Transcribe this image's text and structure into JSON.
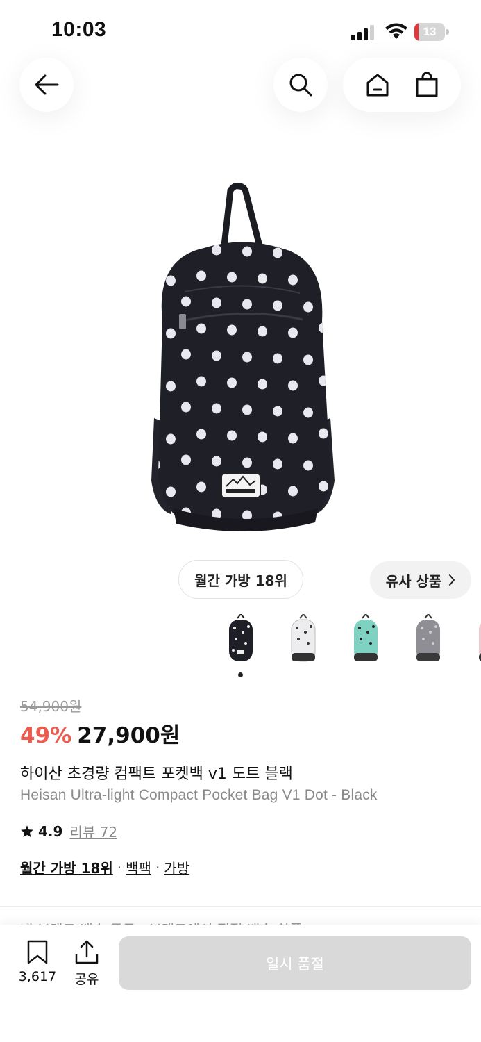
{
  "status_bar": {
    "time": "10:03",
    "battery_level": "13",
    "battery_color": "#e5363d"
  },
  "nav": {
    "icons": [
      "back-arrow-icon",
      "search-icon",
      "home-icon",
      "shopping-bag-icon"
    ]
  },
  "product": {
    "image": "black polka-dot backpack",
    "rank_badge": "월간 가방 18위",
    "similar_label": "유사 상품",
    "thumbnails": [
      "black-dot",
      "white-dot",
      "mint-dot",
      "gray-dot",
      "pink-dot"
    ],
    "original_price": "54,900원",
    "discount": "49%",
    "sale_price": "27,900원",
    "title_ko": "하이산 초경량 컴팩트 포켓백 v1 도트 블랙",
    "title_en": "Heisan Ultra-light Compact Pocket Bag V1 Dot - Black",
    "rating": "4.9",
    "review_label": "리뷰 72",
    "categories": {
      "rank": "월간 가방 18위",
      "sub": "백팩",
      "main": "가방"
    },
    "peek_text": "내 브랜드 배송 무료 · 브랜드에서 직접 배송 상품"
  },
  "bottom_bar": {
    "bookmark_count": "3,617",
    "share_label": "공유",
    "soldout_label": "일시 품절"
  },
  "colors": {
    "discount": "#ec5b4f",
    "soldout_bg": "#d9d9d9"
  }
}
